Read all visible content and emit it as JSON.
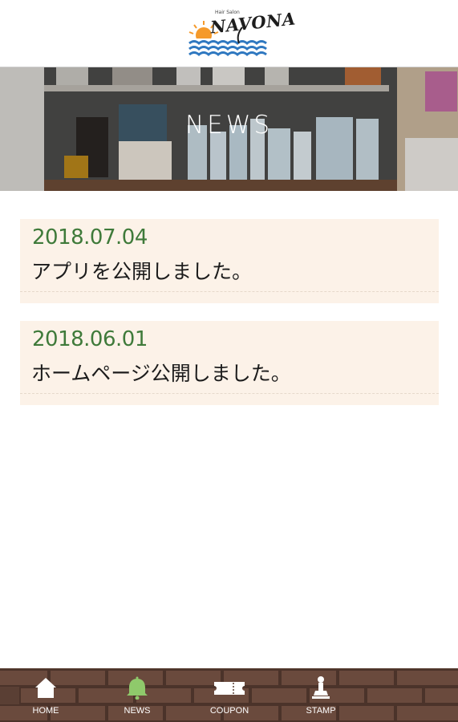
{
  "header": {
    "logo_tagline": "Hair Salon",
    "logo_text": "NAVONA"
  },
  "hero": {
    "title": "NEWS"
  },
  "news": [
    {
      "date": "2018.07.04",
      "text": "アプリを公開しました。"
    },
    {
      "date": "2018.06.01",
      "text": "ホームページ公開しました。"
    }
  ],
  "tabs": [
    {
      "label": "HOME",
      "icon": "home-icon"
    },
    {
      "label": "NEWS",
      "icon": "bell-icon",
      "active": true
    },
    {
      "label": "COUPON",
      "icon": "ticket-icon"
    },
    {
      "label": "STAMP",
      "icon": "stamp-icon"
    }
  ],
  "colors": {
    "accent_green": "#3f7a3a",
    "card_bg": "#fcf2e8",
    "tabbar_brown": "#5a3f34",
    "logo_orange": "#f59a2b",
    "logo_blue": "#2f78c0"
  }
}
